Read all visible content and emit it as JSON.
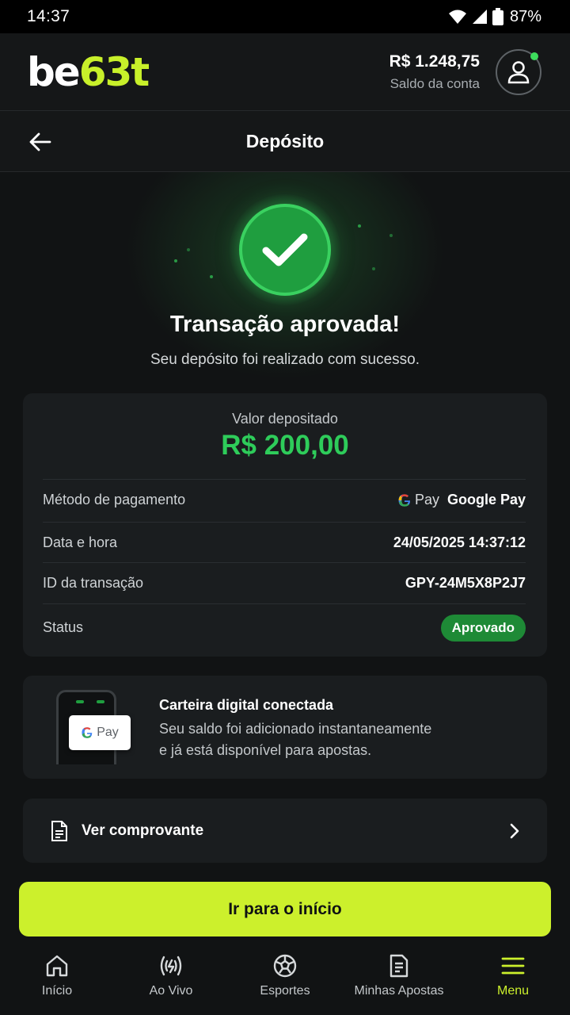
{
  "status_bar": {
    "time": "14:37",
    "battery": "87%"
  },
  "header": {
    "logo_part1": "be",
    "logo_part2": "63t",
    "balance": "R$ 1.248,75",
    "balance_label": "Saldo da conta"
  },
  "titlebar": {
    "title": "Depósito"
  },
  "hero": {
    "title": "Transação aprovada!",
    "subtitle": "Seu depósito foi realizado com sucesso."
  },
  "details": {
    "value_label": "Valor depositado",
    "value_amount": "R$ 200,00",
    "rows": [
      {
        "key": "Método de pagamento",
        "value": "Google Pay",
        "mark": "Pay"
      },
      {
        "key": "Data e hora",
        "value": "24/05/2025 14:37:12"
      },
      {
        "key": "ID da transação",
        "value": "GPY-24M5X8P2J7"
      },
      {
        "key": "Status",
        "value": "Aprovado"
      }
    ]
  },
  "wallet": {
    "card_mark": "Pay",
    "title": "Carteira digital conectada",
    "line1": "Seu saldo foi adicionado instantaneamente",
    "line2": "e já está disponível para apostas."
  },
  "receipt": {
    "label": "Ver comprovante"
  },
  "cta": {
    "label": "Ir para o início"
  },
  "bottom_nav": [
    {
      "label": "Início",
      "icon": "home-icon"
    },
    {
      "label": "Ao Vivo",
      "icon": "live-icon"
    },
    {
      "label": "Esportes",
      "icon": "soccer-ball-icon"
    },
    {
      "label": "Minhas Apostas",
      "icon": "bets-icon"
    },
    {
      "label": "Menu",
      "icon": "menu-icon",
      "active": true
    }
  ],
  "colors": {
    "accent": "#ccf02c",
    "success": "#2ecc5a",
    "badge": "#1e8a36"
  }
}
